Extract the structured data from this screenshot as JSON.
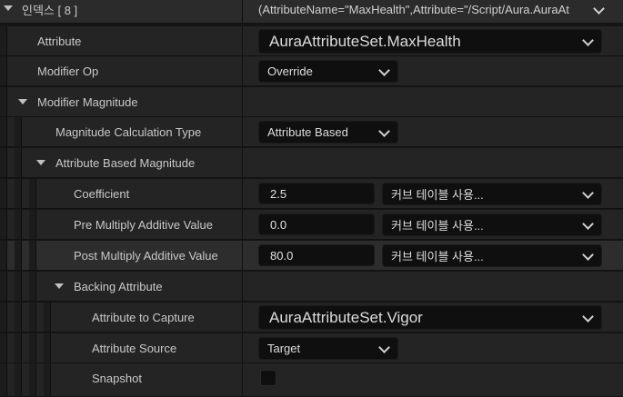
{
  "header": {
    "index_label": "인덱스 [ 8 ]",
    "summary": "(AttributeName=\"MaxHealth\",Attribute=\"/Script/Aura.AuraAt"
  },
  "rows": {
    "attribute": {
      "label": "Attribute",
      "value": "AuraAttributeSet.MaxHealth"
    },
    "modifier_op": {
      "label": "Modifier Op",
      "value": "Override"
    },
    "modifier_magnitude": {
      "label": "Modifier Magnitude"
    },
    "magnitude_calc_type": {
      "label": "Magnitude Calculation Type",
      "value": "Attribute Based"
    },
    "attribute_based_magnitude": {
      "label": "Attribute Based Magnitude"
    },
    "coefficient": {
      "label": "Coefficient",
      "value": "2.5",
      "curve": "커브 테이블 사용..."
    },
    "pre_multiply": {
      "label": "Pre Multiply Additive Value",
      "value": "0.0",
      "curve": "커브 테이블 사용..."
    },
    "post_multiply": {
      "label": "Post Multiply Additive Value",
      "value": "80.0",
      "curve": "커브 테이블 사용..."
    },
    "backing_attribute": {
      "label": "Backing Attribute"
    },
    "attribute_to_capture": {
      "label": "Attribute to Capture",
      "value": "AuraAttributeSet.Vigor"
    },
    "attribute_source": {
      "label": "Attribute Source",
      "value": "Target"
    },
    "snapshot": {
      "label": "Snapshot",
      "checked": false
    }
  }
}
